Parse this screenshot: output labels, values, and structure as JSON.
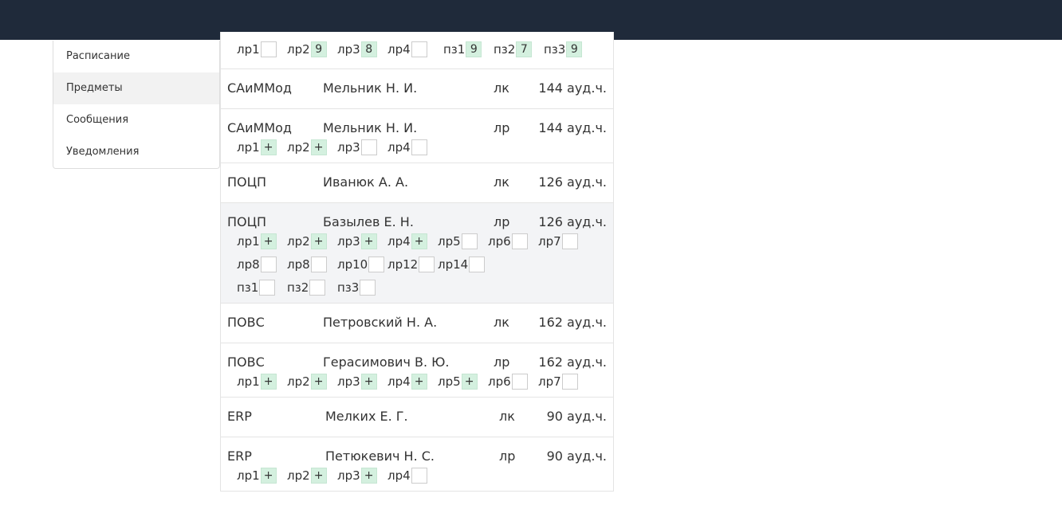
{
  "sidebar": {
    "items": [
      {
        "label": "Расписание",
        "active": false
      },
      {
        "label": "Предметы",
        "active": true
      },
      {
        "label": "Сообщения",
        "active": false
      },
      {
        "label": "Уведомления",
        "active": false
      }
    ]
  },
  "colors": {
    "topbar": "#1f2a3a",
    "filled_mark": "#d4f0df",
    "highlight_row": "#f3f4f6"
  },
  "cards": [
    {
      "partial": true,
      "marks": [
        [
          {
            "label": "лр1",
            "value": ""
          },
          {
            "label": "лр2",
            "value": "9"
          },
          {
            "label": "лр3",
            "value": "8"
          },
          {
            "label": "лр4",
            "value": ""
          },
          {
            "label": "пз1",
            "value": "9"
          },
          {
            "label": "пз2",
            "value": "7"
          },
          {
            "label": "пз3",
            "value": "9"
          }
        ]
      ]
    },
    {
      "subject": "САиММод",
      "teacher": "Мельник Н. И.",
      "type": "лк",
      "hours": "144 ауд.ч.",
      "marks": []
    },
    {
      "subject": "САиММод",
      "teacher": "Мельник Н. И.",
      "type": "лр",
      "hours": "144 ауд.ч.",
      "marks": [
        [
          {
            "label": "лр1",
            "value": "+"
          },
          {
            "label": "лр2",
            "value": "+"
          },
          {
            "label": "лр3",
            "value": ""
          },
          {
            "label": "лр4",
            "value": ""
          }
        ]
      ]
    },
    {
      "subject": "ПОЦП",
      "teacher": "Иванюк А. А.",
      "type": "лк",
      "hours": "126 ауд.ч.",
      "marks": []
    },
    {
      "subject": "ПОЦП",
      "teacher": "Базылев Е. Н.",
      "type": "лр",
      "hours": "126 ауд.ч.",
      "highlight": true,
      "marks": [
        [
          {
            "label": "лр1",
            "value": "+"
          },
          {
            "label": "лр2",
            "value": "+"
          },
          {
            "label": "лр3",
            "value": "+"
          },
          {
            "label": "лр4",
            "value": "+"
          },
          {
            "label": "лр5",
            "value": ""
          },
          {
            "label": "лр6",
            "value": ""
          },
          {
            "label": "лр7",
            "value": ""
          }
        ],
        [
          {
            "label": "лр8",
            "value": ""
          },
          {
            "label": "лр8",
            "value": ""
          },
          {
            "label": "лр10",
            "value": ""
          },
          {
            "label": "лр12",
            "value": ""
          },
          {
            "label": "лр14",
            "value": ""
          }
        ],
        [
          {
            "label": "пз1",
            "value": ""
          },
          {
            "label": "пз2",
            "value": ""
          },
          {
            "label": "пз3",
            "value": ""
          }
        ]
      ]
    },
    {
      "subject": "ПОВС",
      "teacher": "Петровский Н. А.",
      "type": "лк",
      "hours": "162 ауд.ч.",
      "marks": []
    },
    {
      "subject": "ПОВС",
      "teacher": "Герасимович В. Ю.",
      "type": "лр",
      "hours": "162 ауд.ч.",
      "marks": [
        [
          {
            "label": "лр1",
            "value": "+"
          },
          {
            "label": "лр2",
            "value": "+"
          },
          {
            "label": "лр3",
            "value": "+"
          },
          {
            "label": "лр4",
            "value": "+"
          },
          {
            "label": "лр5",
            "value": "+"
          },
          {
            "label": "лр6",
            "value": ""
          },
          {
            "label": "лр7",
            "value": ""
          }
        ]
      ]
    },
    {
      "subject": "ERP",
      "teacher": "Мелких Е. Г.",
      "type": "лк",
      "hours": "90 ауд.ч.",
      "marks": []
    },
    {
      "subject": "ERP",
      "teacher": "Петюкевич Н. С.",
      "type": "лр",
      "hours": "90 ауд.ч.",
      "marks": [
        [
          {
            "label": "лр1",
            "value": "+"
          },
          {
            "label": "лр2",
            "value": "+"
          },
          {
            "label": "лр3",
            "value": "+"
          },
          {
            "label": "лр4",
            "value": ""
          }
        ]
      ]
    }
  ]
}
